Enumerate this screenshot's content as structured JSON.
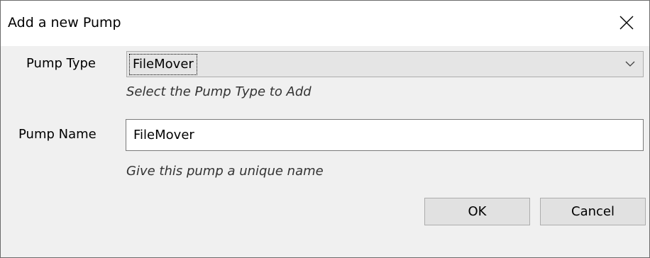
{
  "window": {
    "title": "Add a new Pump",
    "close_icon": "close-icon"
  },
  "pump_type": {
    "label": "Pump Type",
    "selected": "FileMover",
    "hint": "Select the Pump Type to Add",
    "dropdown_icon": "chevron-down-icon"
  },
  "pump_name": {
    "label": "Pump Name",
    "value": "FileMover",
    "hint": "Give this pump  a unique name"
  },
  "buttons": {
    "ok": "OK",
    "cancel": "Cancel"
  }
}
